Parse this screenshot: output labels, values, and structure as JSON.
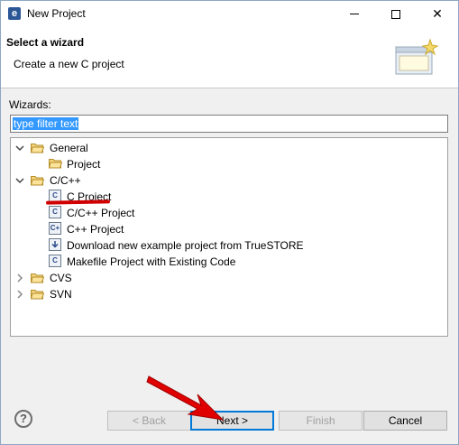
{
  "window": {
    "title": "New Project"
  },
  "header": {
    "title": "Select a wizard",
    "description": "Create a new C project"
  },
  "wizards": {
    "label": "Wizards:",
    "filter_value": "type filter text",
    "tree": [
      {
        "label": "General",
        "expanded": true,
        "type": "folder"
      },
      {
        "label": "Project",
        "type": "item",
        "icon": "project-icon"
      },
      {
        "label": "C/C++",
        "expanded": true,
        "type": "folder"
      },
      {
        "label": "C Project",
        "type": "item",
        "icon": "c-project-icon"
      },
      {
        "label": "C/C++ Project",
        "type": "item",
        "icon": "cpp-project-icon"
      },
      {
        "label": "C++ Project",
        "type": "item",
        "icon": "cplusplus-project-icon"
      },
      {
        "label": "Download new example project from TrueSTORE",
        "type": "item",
        "icon": "download-icon"
      },
      {
        "label": "Makefile Project with Existing Code",
        "type": "item",
        "icon": "makefile-icon"
      },
      {
        "label": "CVS",
        "expanded": false,
        "type": "folder"
      },
      {
        "label": "SVN",
        "expanded": false,
        "type": "folder"
      }
    ]
  },
  "footer": {
    "help": "?",
    "back": "< Back",
    "next": "Next >",
    "finish": "Finish",
    "cancel": "Cancel"
  },
  "colors": {
    "accent": "#0078d7",
    "annotation": "#d10000",
    "selection": "#3399ff"
  }
}
